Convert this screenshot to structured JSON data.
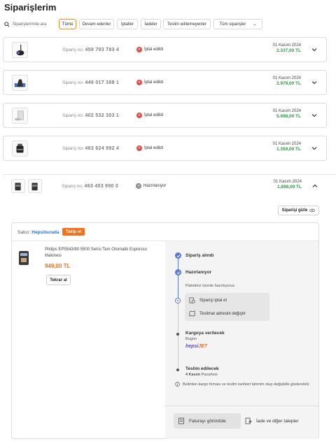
{
  "page": {
    "title": "Siparişlerim"
  },
  "search": {
    "placeholder": "Siparişlerimde ara"
  },
  "filters": [
    {
      "label": "Tümü",
      "active": true
    },
    {
      "label": "Devam edenler"
    },
    {
      "label": "İptaller"
    },
    {
      "label": "İadeler"
    },
    {
      "label": "Teslim edilemeyenler"
    },
    {
      "label": "Tüm siparişler"
    }
  ],
  "orders": [
    {
      "order_label": "Sipariş no:",
      "order_no": "459 793 783 4",
      "status": "İptal edildi",
      "date": "01 Kasım 2024",
      "price": "2.337,00 TL"
    },
    {
      "order_label": "Sipariş no:",
      "order_no": "449 017 388 1",
      "status": "İptal edildi",
      "date": "01 Kasım 2024",
      "price": "2.979,00 TL"
    },
    {
      "order_label": "Sipariş no:",
      "order_no": "402 532 303 1",
      "status": "İptal edildi",
      "date": "01 Kasım 2024",
      "price": "5.998,00 TL"
    },
    {
      "order_label": "Sipariş no:",
      "order_no": "463 624 992 4",
      "status": "İptal edildi",
      "date": "01 Kasım 2024",
      "price": "1.359,00 TL"
    },
    {
      "order_label": "Sipariş no:",
      "order_no": "463 403 990 0",
      "status": "Hazırlanıyor",
      "date": "01 Kasım 2024",
      "price": "1.898,00 TL"
    }
  ],
  "expanded": {
    "hide_label": "Siparişi gizle",
    "seller_label": "Satıcı:",
    "seller_name": "Hepsiburada",
    "follow_label": "Takip et",
    "product_name": "Philips EP5543/80 5500 Serisi Tam Otomatik Espresso Makinesi",
    "product_price": "949,00 TL",
    "buy_again": "Tekrar al",
    "timeline": {
      "step1": "Sipariş alındı",
      "step2": "Hazırlanıyor",
      "step2_sub": "Paketiniz özenle hazırlıyoruz.",
      "cancel_action": "Siparişi iptal et",
      "address_action": "Teslimat adresini değiştir",
      "step3": "Kargoya verilecek",
      "step3_sub": "Bugün",
      "carrier_a": "hepsi",
      "carrier_b": "JET",
      "step4": "Teslim edilecek",
      "step4_date": "4 Kasım",
      "step4_day": "Pazartesi",
      "note": "Belirtilen kargo firması ve teslim tarihleri tahmini olup değişiklik gösterebilir."
    },
    "invoice_label": "Faturayı görüntüle",
    "return_label": "İade ve diğer talepler"
  },
  "colors": {
    "accent": "#f3701d",
    "price": "#2d9a4a",
    "timeline": "#5a7bd6",
    "cancel": "#e24b4b"
  }
}
